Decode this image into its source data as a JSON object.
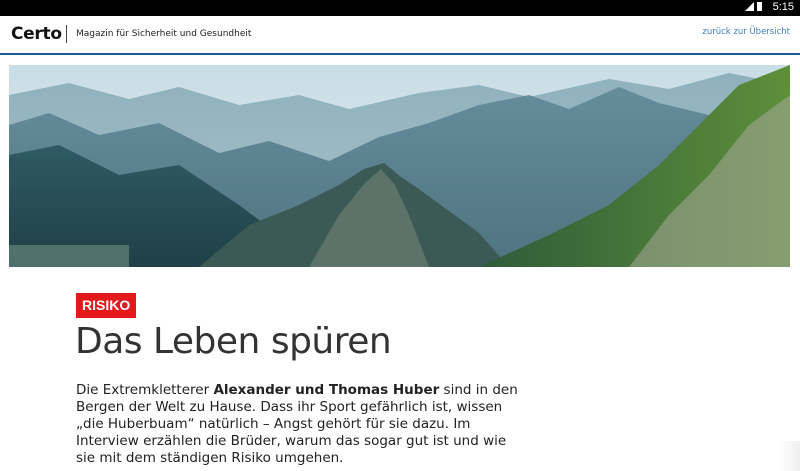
{
  "status_bar": {
    "time": "5:15",
    "icons": [
      "signal-icon",
      "battery-icon"
    ]
  },
  "header": {
    "logo": "Certo",
    "tagline": "Magazin für Sicherheit und Gesundheit",
    "back_link": "zurück zur Übersicht"
  },
  "hero": {
    "image": "mountain-landscape"
  },
  "article": {
    "category": "RISIKO",
    "title": "Das Leben spüren",
    "lead_before": "Die Extremkletterer ",
    "lead_bold": "Alexander und Thomas Huber",
    "lead_after": " sind in den Bergen der Welt zu Hause. Dass ihr Sport gefährlich ist, wissen „die Huberbuam“ natürlich – Angst gehört für sie dazu. Im Interview erzählen die Brüder, warum das sogar gut ist und wie sie mit dem ständigen Risiko umgehen."
  },
  "colors": {
    "accent": "#e4191b",
    "link": "#3d7fc1",
    "header_rule": "#1f5b8f"
  }
}
